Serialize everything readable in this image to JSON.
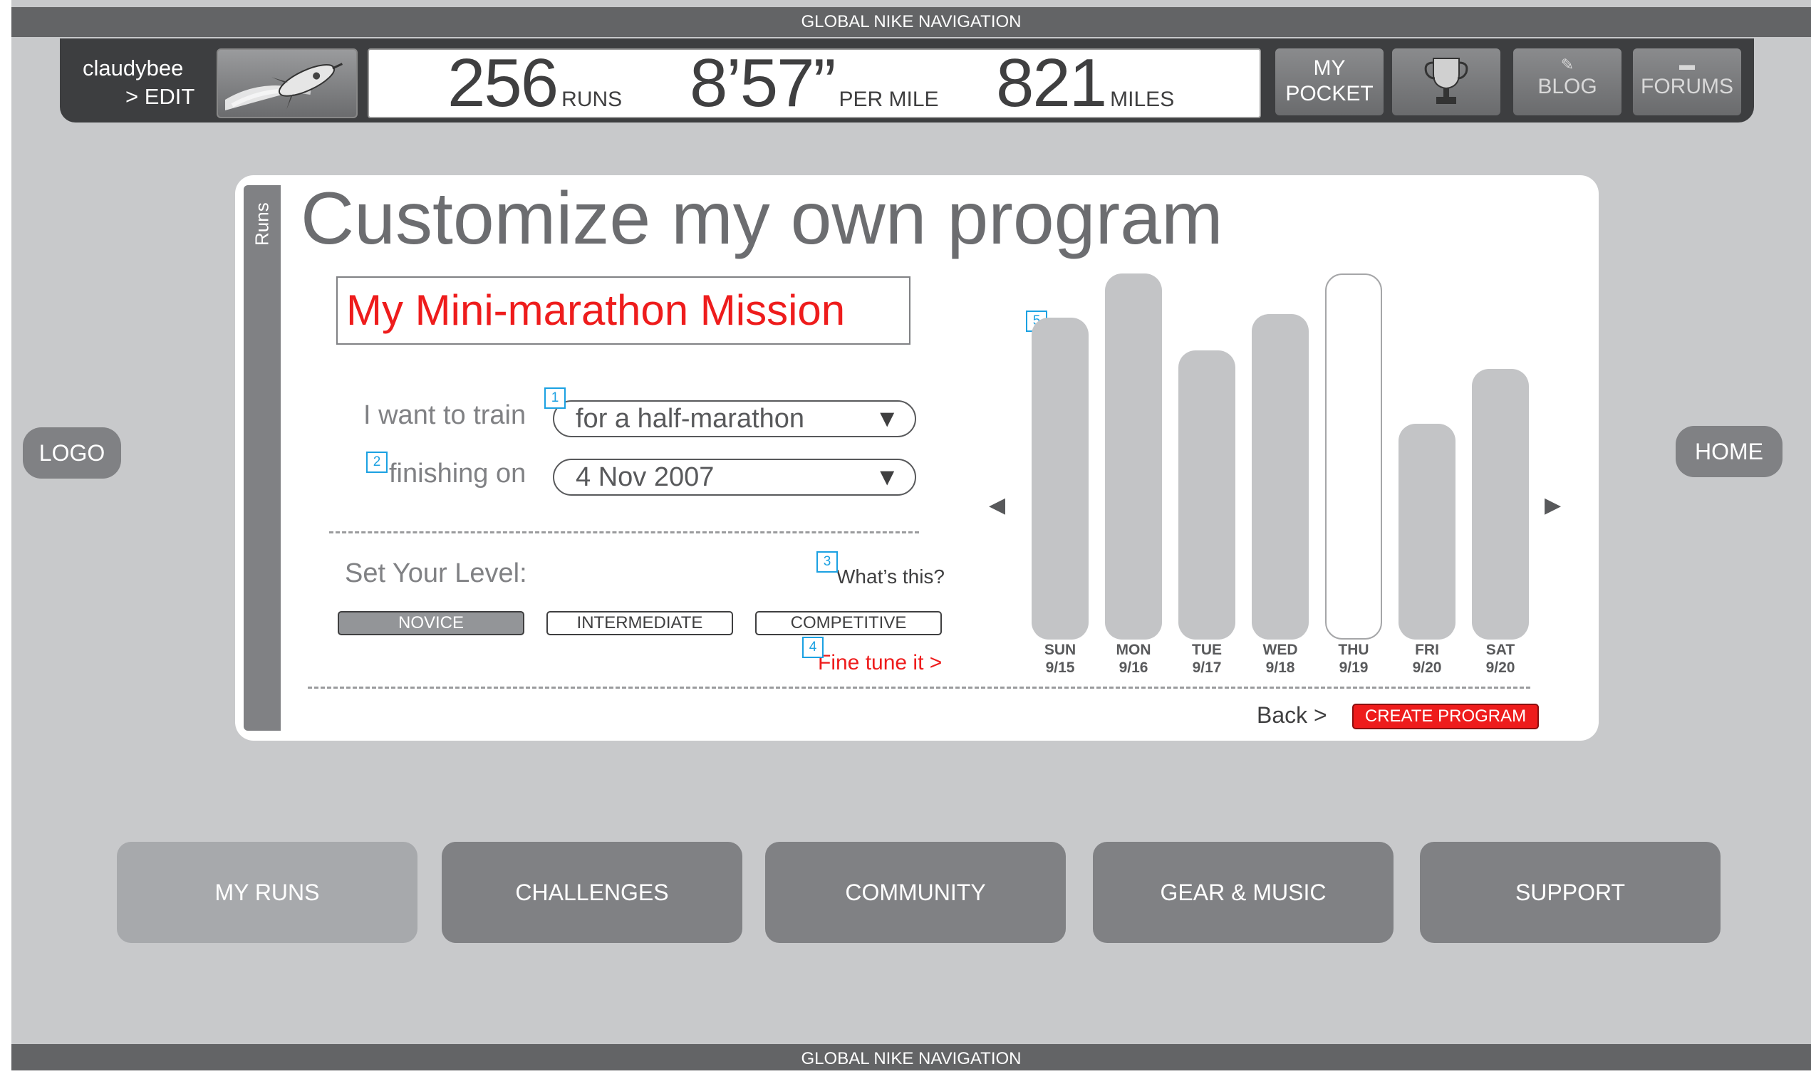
{
  "global_nav": {
    "label": "GLOBAL NIKE NAVIGATION"
  },
  "header": {
    "user": {
      "name": "claudybee",
      "edit": "> EDIT"
    },
    "stats": [
      {
        "value": "256",
        "unit": "RUNS"
      },
      {
        "value": "8’57”",
        "unit": "PER MILE"
      },
      {
        "value": "821",
        "unit": "MILES"
      }
    ],
    "buttons": {
      "pocket": "MY\nPOCKET",
      "blog": "BLOG",
      "forums": "FORUMS"
    }
  },
  "side": {
    "logo": "LOGO",
    "home": "HOME"
  },
  "card": {
    "tab": "Runs",
    "title": "Customize my own program",
    "program_name": "My Mini-marathon Mission",
    "train_label": "I want to train",
    "train_value": "for a half-marathon",
    "finish_label": "finishing on",
    "finish_value": "4 Nov 2007",
    "level_label": "Set Your Level:",
    "whats_this": "What’s this?",
    "levels": [
      "NOVICE",
      "INTERMEDIATE",
      "COMPETITIVE"
    ],
    "fine_tune": "Fine tune it >",
    "back": "Back >",
    "create": "CREATE PROGRAM",
    "markers": [
      "1",
      "2",
      "3",
      "4",
      "5"
    ],
    "week": [
      {
        "day": "SUN",
        "date": "9/15",
        "level": 0.88
      },
      {
        "day": "MON",
        "date": "9/16",
        "level": 1.0
      },
      {
        "day": "TUE",
        "date": "9/17",
        "level": 0.79
      },
      {
        "day": "WED",
        "date": "9/18",
        "level": 0.89
      },
      {
        "day": "THU",
        "date": "9/19",
        "level": 1.0
      },
      {
        "day": "FRI",
        "date": "9/20",
        "level": 0.59
      },
      {
        "day": "SAT",
        "date": "9/20",
        "level": 0.74
      }
    ]
  },
  "bottom_nav": [
    "MY RUNS",
    "CHALLENGES",
    "COMMUNITY",
    "GEAR & MUSIC",
    "SUPPORT"
  ]
}
